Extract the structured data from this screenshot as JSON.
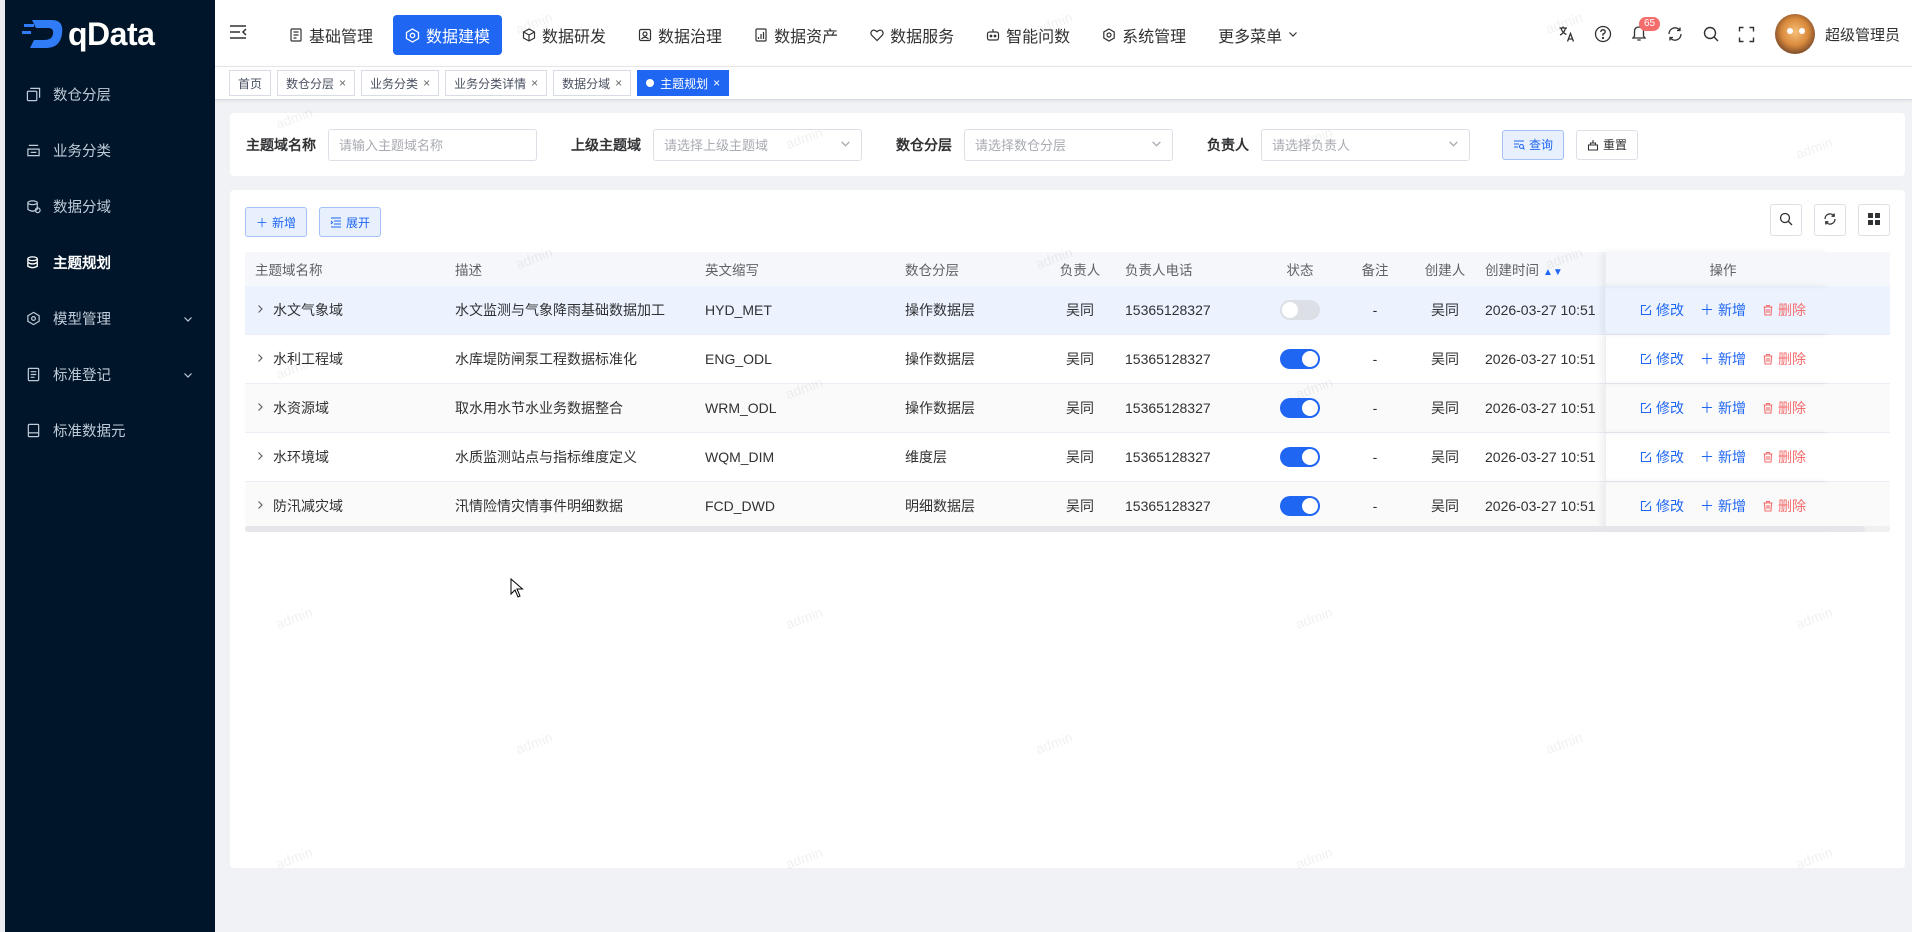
{
  "brand": {
    "name": "qData"
  },
  "sidebar": {
    "items": [
      {
        "label": "数仓分层",
        "icon": "layers-icon"
      },
      {
        "label": "业务分类",
        "icon": "category-icon"
      },
      {
        "label": "数据分域",
        "icon": "domain-icon"
      },
      {
        "label": "主题规划",
        "icon": "topic-icon",
        "active": true
      },
      {
        "label": "模型管理",
        "icon": "model-icon",
        "expandable": true
      },
      {
        "label": "标准登记",
        "icon": "register-icon",
        "expandable": true
      },
      {
        "label": "标准数据元",
        "icon": "data-element-icon"
      }
    ]
  },
  "topnav": {
    "items": [
      {
        "label": "基础管理",
        "icon": "basic-icon"
      },
      {
        "label": "数据建模",
        "icon": "modeling-icon",
        "active": true
      },
      {
        "label": "数据研发",
        "icon": "dev-icon"
      },
      {
        "label": "数据治理",
        "icon": "governance-icon"
      },
      {
        "label": "数据资产",
        "icon": "asset-icon"
      },
      {
        "label": "数据服务",
        "icon": "service-icon"
      },
      {
        "label": "智能问数",
        "icon": "robot-icon"
      },
      {
        "label": "系统管理",
        "icon": "settings-icon"
      },
      {
        "label": "更多菜单",
        "icon": "",
        "dropdown": true
      }
    ]
  },
  "header": {
    "notification_count": "65",
    "username": "超级管理员"
  },
  "tags": [
    {
      "label": "首页",
      "closable": false
    },
    {
      "label": "数仓分层",
      "closable": true
    },
    {
      "label": "业务分类",
      "closable": true
    },
    {
      "label": "业务分类详情",
      "closable": true
    },
    {
      "label": "数据分域",
      "closable": true
    },
    {
      "label": "主题规划",
      "closable": true,
      "active": true
    }
  ],
  "search": {
    "name_label": "主题域名称",
    "name_placeholder": "请输入主题域名称",
    "parent_label": "上级主题域",
    "parent_placeholder": "请选择上级主题域",
    "layer_label": "数仓分层",
    "layer_placeholder": "请选择数仓分层",
    "owner_label": "负责人",
    "owner_placeholder": "请选择负责人",
    "query_label": "查询",
    "reset_label": "重置"
  },
  "toolbar": {
    "add_label": "新增",
    "expand_label": "展开"
  },
  "table": {
    "columns": [
      "主题域名称",
      "描述",
      "英文缩写",
      "数仓分层",
      "负责人",
      "负责人电话",
      "状态",
      "备注",
      "创建人",
      "创建时间",
      "操作"
    ],
    "rows": [
      {
        "name": "水文气象域",
        "desc": "水文监测与气象降雨基础数据加工",
        "abbr": "HYD_MET",
        "layer": "操作数据层",
        "owner": "吴同",
        "phone": "15365128327",
        "status": false,
        "remark": "-",
        "creator": "吴同",
        "created": "2026-03-27 10:51"
      },
      {
        "name": "水利工程域",
        "desc": "水库堤防闸泵工程数据标准化",
        "abbr": "ENG_ODL",
        "layer": "操作数据层",
        "owner": "吴同",
        "phone": "15365128327",
        "status": true,
        "remark": "-",
        "creator": "吴同",
        "created": "2026-03-27 10:51"
      },
      {
        "name": "水资源域",
        "desc": "取水用水节水业务数据整合",
        "abbr": "WRM_ODL",
        "layer": "操作数据层",
        "owner": "吴同",
        "phone": "15365128327",
        "status": true,
        "remark": "-",
        "creator": "吴同",
        "created": "2026-03-27 10:51"
      },
      {
        "name": "水环境域",
        "desc": "水质监测站点与指标维度定义",
        "abbr": "WQM_DIM",
        "layer": "维度层",
        "owner": "吴同",
        "phone": "15365128327",
        "status": true,
        "remark": "-",
        "creator": "吴同",
        "created": "2026-03-27 10:51"
      },
      {
        "name": "防汛减灾域",
        "desc": "汛情险情灾情事件明细数据",
        "abbr": "FCD_DWD",
        "layer": "明细数据层",
        "owner": "吴同",
        "phone": "15365128327",
        "status": true,
        "remark": "-",
        "creator": "吴同",
        "created": "2026-03-27 10:51"
      }
    ],
    "actions": {
      "edit": "修改",
      "add": "新增",
      "delete": "删除"
    }
  },
  "watermark": "admin",
  "colors": {
    "primary": "#1f66f2",
    "sidebar_bg": "#001529",
    "danger": "#f56c6c"
  }
}
